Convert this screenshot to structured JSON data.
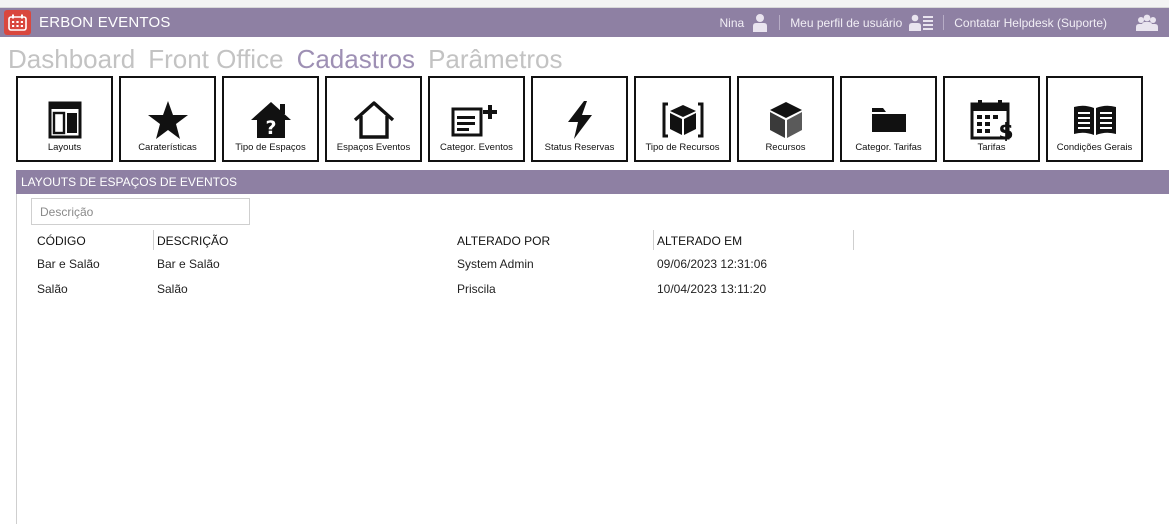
{
  "app": {
    "title": "ERBON EVENTOS",
    "accent_color": "#8e80a3",
    "logo_color": "#d9473e"
  },
  "topbar": {
    "user_name": "Nina",
    "profile_label": "Meu perfil de usuário",
    "helpdesk_label": "Contatar Helpdesk (Suporte)"
  },
  "nav": {
    "items": [
      {
        "label": "Dashboard",
        "active": false
      },
      {
        "label": "Front Office",
        "active": false
      },
      {
        "label": "Cadastros",
        "active": true
      },
      {
        "label": "Parâmetros",
        "active": false
      }
    ]
  },
  "tiles": [
    {
      "label": "Layouts",
      "icon": "layout-icon"
    },
    {
      "label": "Caraterísticas",
      "icon": "star-icon"
    },
    {
      "label": "Tipo de Espaços",
      "icon": "house-question-icon"
    },
    {
      "label": "Espaços Eventos",
      "icon": "house-outline-icon"
    },
    {
      "label": "Categor. Eventos",
      "icon": "list-plus-icon"
    },
    {
      "label": "Status Reservas",
      "icon": "bolt-icon"
    },
    {
      "label": "Tipo de Recursos",
      "icon": "cube-brackets-icon"
    },
    {
      "label": "Recursos",
      "icon": "cube-icon"
    },
    {
      "label": "Categor. Tarifas",
      "icon": "folder-icon"
    },
    {
      "label": "Tarifas",
      "icon": "calendar-dollar-icon"
    },
    {
      "label": "Condições Gerais",
      "icon": "book-icon"
    }
  ],
  "section": {
    "title": "LAYOUTS DE ESPAÇOS DE EVENTOS"
  },
  "search": {
    "placeholder": "Descrição",
    "value": ""
  },
  "table": {
    "columns": [
      "CÓDIGO",
      "DESCRIÇÃO",
      "ALTERADO POR",
      "ALTERADO EM"
    ],
    "rows": [
      [
        "Bar e Salão",
        "Bar e Salão",
        "System Admin",
        "09/06/2023 12:31:06"
      ],
      [
        "Salão",
        "Salão",
        "Priscila",
        "10/04/2023 13:11:20"
      ]
    ]
  }
}
